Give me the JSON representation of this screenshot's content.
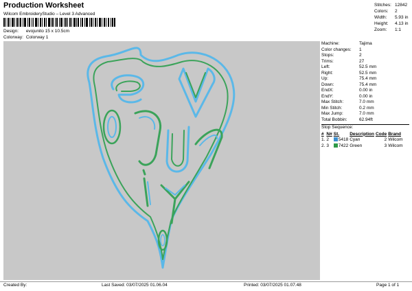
{
  "header": {
    "title": "Production Worksheet",
    "subtitle": "Wilcom EmbroideryStudio – Level 3 Advanced"
  },
  "meta": {
    "design_label": "Design:",
    "design_value": "evojunito 15 x 10.5cm",
    "colorway_label": "Colorway:",
    "colorway_value": "Colorway 1"
  },
  "stats": [
    {
      "k": "Stitches:",
      "v": "12842"
    },
    {
      "k": "Colors:",
      "v": "2"
    },
    {
      "k": "Width:",
      "v": "5.93 in"
    },
    {
      "k": "Height:",
      "v": "4.13 in"
    },
    {
      "k": "Zoom:",
      "v": "1:1"
    }
  ],
  "details": [
    {
      "k": "Machine:",
      "v": "Tajima"
    },
    {
      "k": "Color changes:",
      "v": "1"
    },
    {
      "k": "Stops:",
      "v": "2"
    },
    {
      "k": "Trims:",
      "v": "27"
    },
    {
      "k": "Left:",
      "v": "52.5 mm"
    },
    {
      "k": "Right:",
      "v": "52.5 mm"
    },
    {
      "k": "Up:",
      "v": "75.4 mm"
    },
    {
      "k": "Down:",
      "v": "75.4 mm"
    },
    {
      "k": "EndX:",
      "v": "0.00 in"
    },
    {
      "k": "EndY:",
      "v": "0.00 in"
    },
    {
      "k": "Max Stitch:",
      "v": "7.0 mm"
    },
    {
      "k": "Min Stitch:",
      "v": "0.2 mm"
    },
    {
      "k": "Max Jump:",
      "v": "7.0 mm"
    },
    {
      "k": "Total Bobbin:",
      "v": "62.94ft"
    }
  ],
  "sequence": {
    "title": "Stop Sequence:",
    "headers": [
      "#",
      "N#",
      "St.",
      "Description",
      "Code",
      "Brand"
    ],
    "rows": [
      {
        "num": "1.",
        "n": "2",
        "st": "5418",
        "desc": "Cyan",
        "code": "2",
        "brand": "Wilcom",
        "color": "#3a8fd0"
      },
      {
        "num": "2.",
        "n": "3",
        "st": "7422",
        "desc": "Green",
        "code": "3",
        "brand": "Wilcom",
        "color": "#2e9a48"
      }
    ]
  },
  "footer": {
    "created_by": "Created By:",
    "last_saved": "Last Saved: 03/07/2025 01.06.04",
    "printed": "Printed: 03/07/2025 01.07.48",
    "page": "Page 1 of 1"
  },
  "colors": {
    "canvas_bg": "#c8c8c8",
    "cyan": "#5bb8e8",
    "green": "#3ba35a"
  }
}
